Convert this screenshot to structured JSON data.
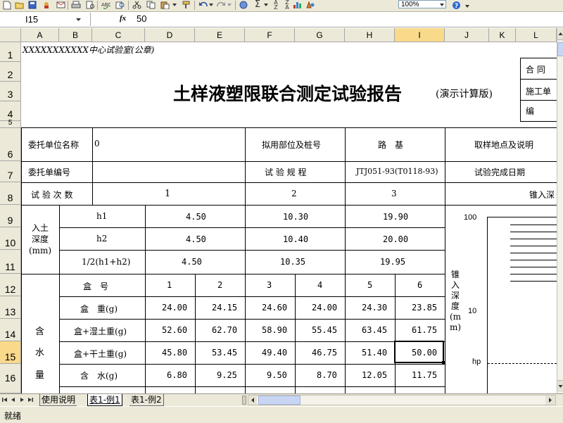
{
  "toolbar": {
    "zoom": "100%"
  },
  "formula_bar": {
    "cell_ref": "I15",
    "fx": "fx",
    "value": "50"
  },
  "columns": [
    "A",
    "B",
    "C",
    "D",
    "E",
    "F",
    "G",
    "H",
    "I",
    "J",
    "K",
    "L"
  ],
  "rows": [
    "1",
    "2",
    "3",
    "4",
    "5",
    "6",
    "7",
    "8",
    "9",
    "10",
    "11",
    "12",
    "13",
    "14",
    "15",
    "16"
  ],
  "sheet": {
    "lab_name": "XXXXXXXXXXX中心试验室(公章)",
    "title": "土样液塑限联合测定试验报告",
    "title_suffix": "(演示计算版)",
    "right_labels": [
      "合 同",
      "施工单",
      "编"
    ],
    "client_name_label": "委托单位名称",
    "client_name_value": "0",
    "planned_site_label": "拟用部位及桩号",
    "planned_site_value": "路　基",
    "sampling_label": "取样地点及说明",
    "client_no_label": "委托单编号",
    "spec_label": "试 验 规 程",
    "spec_value": "JTJ051-93(T0118-93)",
    "finish_date_label": "试验完成日期",
    "test_count_label": "试 验 次 数",
    "test_counts": [
      "1",
      "2",
      "3"
    ],
    "cone_depth_label": "锥入深",
    "depth_label": "入土深度(mm)",
    "h1_label": "h1",
    "h2_label": "h2",
    "havg_label": "1/2(h1+h2)",
    "h1": [
      "4.50",
      "10.30",
      "19.90"
    ],
    "h2": [
      "4.50",
      "10.40",
      "20.00"
    ],
    "havg": [
      "4.50",
      "10.35",
      "19.95"
    ],
    "box_no_label": "盒　号",
    "box_no": [
      "1",
      "2",
      "3",
      "4",
      "5",
      "6"
    ],
    "box_wt_label": "盒　重(g)",
    "box_wt": [
      "24.00",
      "24.15",
      "24.60",
      "24.00",
      "24.30",
      "23.85"
    ],
    "wet_label": "盒+湿土重(g)",
    "wet": [
      "52.60",
      "62.70",
      "58.90",
      "55.45",
      "63.45",
      "61.75"
    ],
    "dry_label": "盒+干土重(g)",
    "dry": [
      "45.80",
      "53.45",
      "49.40",
      "46.75",
      "51.40",
      "50.00"
    ],
    "water_label": "含　水(g)",
    "water": [
      "6.80",
      "9.25",
      "9.50",
      "8.70",
      "12.05",
      "11.75"
    ],
    "moisture_label": [
      "含",
      "水",
      "量"
    ],
    "chart_y_label": "锥入深度(mm)",
    "chart_ticks": [
      "100",
      "10",
      "hp"
    ]
  },
  "sheet_tabs": [
    "使用说明",
    "表1-例1",
    "表1-例2"
  ],
  "status": "就绪"
}
